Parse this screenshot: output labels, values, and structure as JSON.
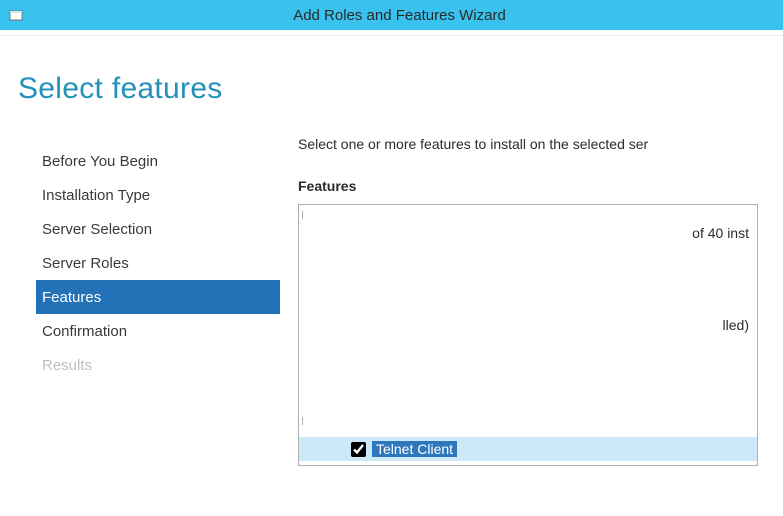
{
  "window": {
    "title": "Add Roles and Features Wizard"
  },
  "page": {
    "title": "Select features"
  },
  "sidebar": {
    "items": [
      {
        "label": "Before You Begin",
        "state": "normal"
      },
      {
        "label": "Installation Type",
        "state": "normal"
      },
      {
        "label": "Server Selection",
        "state": "normal"
      },
      {
        "label": "Server Roles",
        "state": "normal"
      },
      {
        "label": "Features",
        "state": "active"
      },
      {
        "label": "Confirmation",
        "state": "normal"
      },
      {
        "label": "Results",
        "state": "disabled"
      }
    ]
  },
  "main": {
    "instruction": "Select one or more features to install on the selected ser",
    "section_label": "Features",
    "fragment_top": "of 40 inst",
    "fragment_mid": "lled)",
    "selected_item": {
      "label": "Telnet Client",
      "checked": true
    }
  }
}
